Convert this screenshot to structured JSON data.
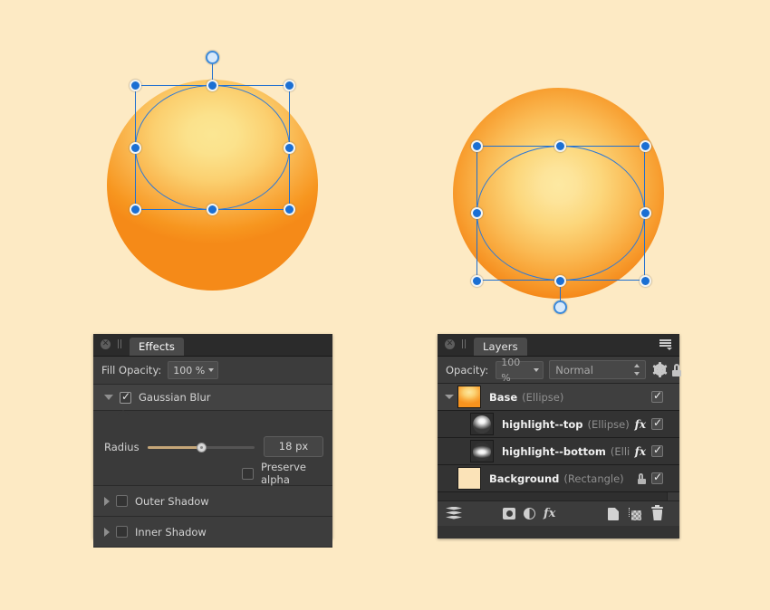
{
  "background_color": "#fdeac4",
  "canvas": {
    "shapes": [
      {
        "name": "sphere-left",
        "description": "orange sphere with top highlight, selected",
        "selection": {
          "rotation_handle_position": "top",
          "handle_count": 8
        }
      },
      {
        "name": "sphere-right",
        "description": "orange sphere with centered highlight, selected",
        "selection": {
          "rotation_handle_position": "bottom",
          "handle_count": 8
        }
      }
    ],
    "accent_color": "#1b6fd3",
    "sphere_highlight_color": "#fbe693",
    "sphere_edge_color": "#f7931e"
  },
  "effects_panel": {
    "close_icon": "close-icon",
    "grip_icon": "drag-grip-icon",
    "tab_label": "Effects",
    "fill_opacity_label": "Fill Opacity:",
    "fill_opacity_value": "100 %",
    "sections": [
      {
        "label": "Gaussian Blur",
        "expanded": true,
        "checked": true
      },
      {
        "label": "Outer Shadow",
        "expanded": false,
        "checked": false
      },
      {
        "label": "Inner Shadow",
        "expanded": false,
        "checked": false
      }
    ],
    "radius_label": "Radius",
    "radius_value": "18 px",
    "radius_slider_percent": 50,
    "preserve_alpha_label": "Preserve alpha",
    "preserve_alpha_checked": false,
    "slider_fill_color": "#c5a678"
  },
  "layers_panel": {
    "close_icon": "close-icon",
    "grip_icon": "drag-grip-icon",
    "tab_label": "Layers",
    "menu_icon": "hamburger-menu-icon",
    "opacity_label": "Opacity:",
    "opacity_value": "100 %",
    "blend_mode": "Normal",
    "gear_icon": "gear-icon",
    "lock_icon": "lock-icon",
    "layers": [
      {
        "name": "Base",
        "type": "(Ellipse)",
        "has_expander": true,
        "has_fx": false,
        "locked": false,
        "visible": true,
        "selected": true,
        "indent": false,
        "thumbnail": "orange-sphere-thumbnail"
      },
      {
        "name": "highlight--top",
        "type": "(Ellipse)",
        "has_expander": false,
        "has_fx": true,
        "locked": false,
        "visible": true,
        "selected": false,
        "indent": true,
        "thumbnail": "white-top-highlight-thumbnail"
      },
      {
        "name": "highlight--bottom",
        "type": "(Ellip",
        "has_expander": false,
        "has_fx": true,
        "locked": false,
        "visible": true,
        "selected": false,
        "indent": true,
        "thumbnail": "white-bottom-highlight-thumbnail"
      },
      {
        "name": "Background",
        "type": "(Rectangle)",
        "has_expander": false,
        "has_fx": false,
        "locked": true,
        "visible": true,
        "selected": false,
        "indent": false,
        "thumbnail": "cream-rectangle-thumbnail"
      }
    ],
    "fx_label": "fx",
    "toolbar_icons": [
      "layer-stack-icon",
      "add-mask-icon",
      "add-adjustment-icon",
      "add-effect-fx-icon",
      "new-layer-icon",
      "duplicate-layer-icon",
      "delete-layer-icon"
    ]
  }
}
